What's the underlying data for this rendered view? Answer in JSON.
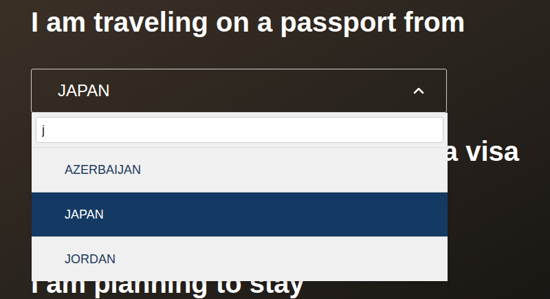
{
  "page": {
    "heading": "I am traveling on a passport from"
  },
  "select": {
    "value": "JAPAN",
    "expanded": true
  },
  "search": {
    "value": "j"
  },
  "options": [
    {
      "label": "AZERBAIJAN",
      "selected": false
    },
    {
      "label": "JAPAN",
      "selected": true
    },
    {
      "label": "JORDAN",
      "selected": false
    }
  ],
  "partial_headings": {
    "visa": "a visa",
    "stay": "I am planning to stay"
  }
}
